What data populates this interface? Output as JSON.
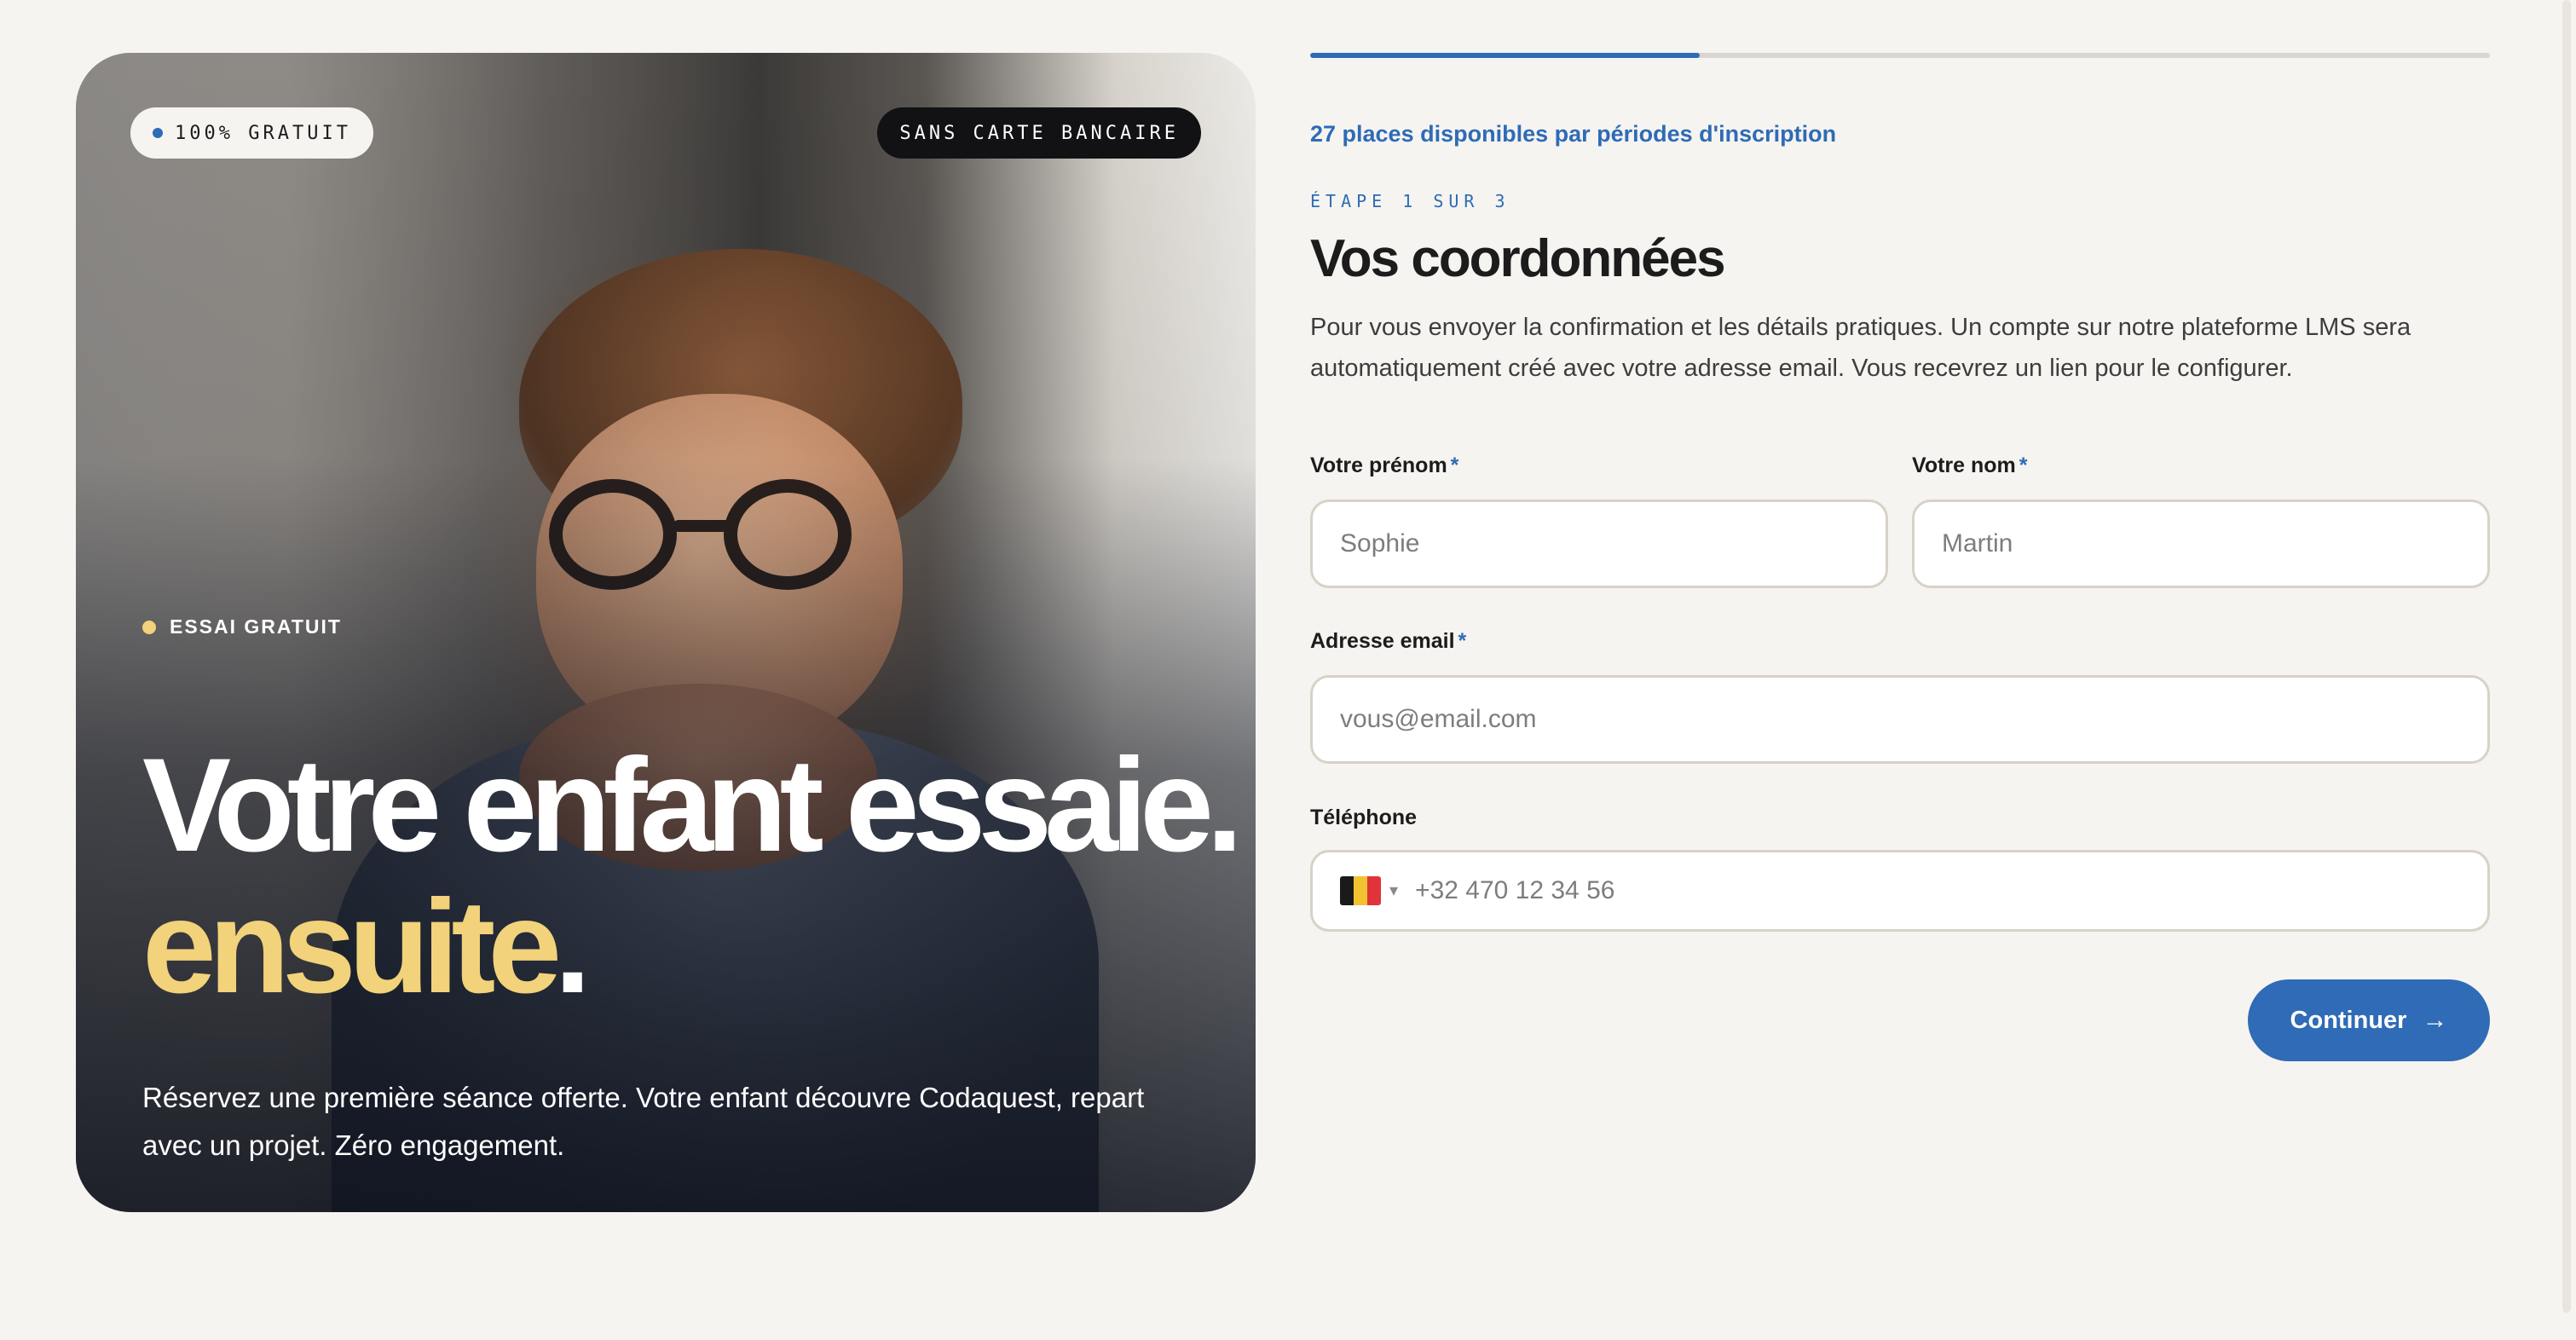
{
  "hero": {
    "badge_left": "100% GRATUIT",
    "badge_right": "SANS CARTE BANCAIRE",
    "eyebrow": "ESSAI GRATUIT",
    "title_line1": "Votre enfant essaie.",
    "title_accent": "ensuite",
    "title_period": ".",
    "subtitle": "Réservez une première séance offerte. Votre enfant découvre Codaquest, repart avec un projet. Zéro engagement."
  },
  "form": {
    "progress": 0.33,
    "places_text": "27 places disponibles par périodes d'inscription",
    "step_label": "ÉTAPE 1 SUR 3",
    "title": "Vos coordonnées",
    "description": "Pour vous envoyer la confirmation et les détails pratiques. Un compte sur notre plateforme LMS sera automatiquement créé avec votre adresse email. Vous recevrez un lien pour le configurer.",
    "first_name": {
      "label": "Votre prénom",
      "required_mark": "*",
      "placeholder": "Sophie"
    },
    "last_name": {
      "label": "Votre nom",
      "required_mark": "*",
      "placeholder": "Martin"
    },
    "email": {
      "label": "Adresse email",
      "required_mark": "*",
      "placeholder": "vous@email.com"
    },
    "phone": {
      "label": "Téléphone",
      "country": "BE",
      "flag_colors": [
        "#1a1a1a",
        "#f2c230",
        "#e0343a"
      ],
      "chevron": "▾",
      "placeholder": "+32 470 12 34 56"
    },
    "continue_label": "Continuer",
    "continue_icon": "→"
  },
  "colors": {
    "accent": "#2f6bb6",
    "highlight": "#f2d27a",
    "background": "#f5f4f1"
  }
}
